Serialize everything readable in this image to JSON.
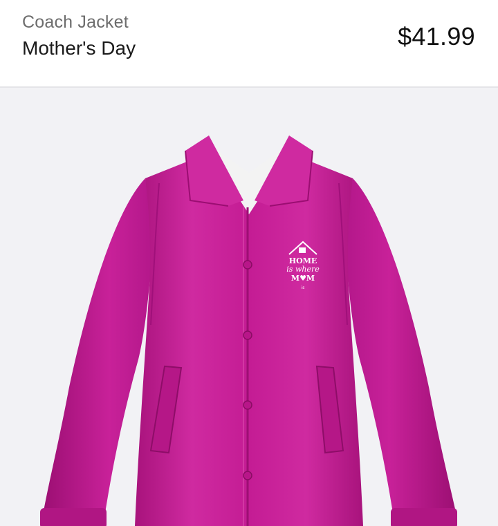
{
  "product": {
    "type": "Coach Jacket",
    "name": "Mother's Day",
    "price": "$41.99"
  },
  "print": {
    "line1": "HOME",
    "line2": "is where",
    "line3": "M♥M",
    "line4": "is"
  },
  "colors": {
    "jacket": "#c41c94",
    "lining": "#f3f3f3",
    "background": "#f2f2f5",
    "print_text": "#ffffff",
    "heart": "#ef5f7a"
  }
}
